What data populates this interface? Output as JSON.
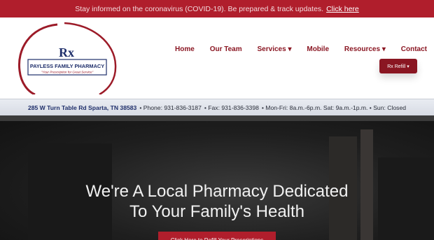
{
  "announcement": {
    "text": "Stay informed on the coronavirus (COVID-19). Be prepared & track updates.",
    "link": "Click here"
  },
  "logo": {
    "mark": "Rx",
    "name": "PAYLESS FAMILY PHARMACY",
    "tagline": "\"Your Prescription for Great Service\""
  },
  "nav": {
    "items": [
      {
        "label": "Home"
      },
      {
        "label": "Our Team"
      },
      {
        "label": "Services ▾"
      },
      {
        "label": "Mobile"
      },
      {
        "label": "Resources ▾"
      },
      {
        "label": "Contact"
      }
    ],
    "rx_button": "Rx Refill ▾"
  },
  "info": {
    "address": "285 W Turn Table Rd Sparta, TN 38583",
    "phone": "• Phone: 931-836-3187",
    "fax": "• Fax: 931-836-3398",
    "hours": "• Mon-Fri: 8a.m.-6p.m. Sat: 9a.m.-1p.m. • Sun: Closed"
  },
  "hero": {
    "line1": "We're A Local Pharmacy Dedicated",
    "line2": "To Your Family's Health",
    "button": "Click Here to Refill Your Prescriptions"
  },
  "colors": {
    "brand_red": "#b01e2c",
    "brand_dark_red": "#8a1622",
    "brand_navy": "#1f2f6b"
  }
}
